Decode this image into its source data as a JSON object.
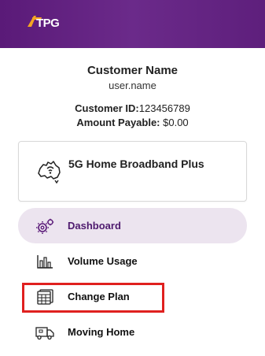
{
  "header": {
    "logo_text": "TPG",
    "brand_colors": {
      "header_bg": "#5e1f7c",
      "logo_accent": "#f5a623"
    }
  },
  "customer": {
    "name": "Customer Name",
    "username": "user.name",
    "id_label": "Customer ID:",
    "id_value": "123456789",
    "amount_label": "Amount Payable:",
    "amount_value": " $0.00"
  },
  "plan": {
    "icon": "australia-map-wifi-icon",
    "title": "5G Home Broadband Plus"
  },
  "nav": {
    "items": [
      {
        "label": "Dashboard",
        "icon": "gears-icon",
        "active": true
      },
      {
        "label": "Volume Usage",
        "icon": "bar-chart-icon",
        "active": false
      },
      {
        "label": "Change Plan",
        "icon": "plan-cards-icon",
        "active": false
      },
      {
        "label": "Moving Home",
        "icon": "moving-truck-icon",
        "active": false
      }
    ]
  },
  "colors": {
    "active_item_bg": "#ece4ef",
    "active_text": "#4e1a6e",
    "highlight_border": "#e0201f"
  }
}
